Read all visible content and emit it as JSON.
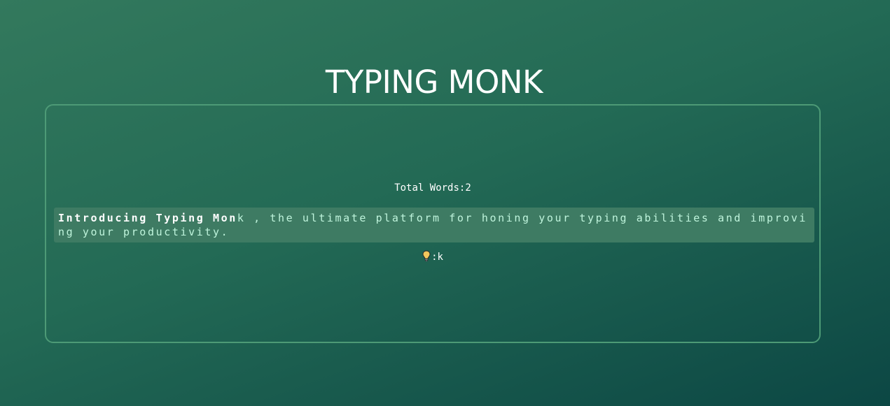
{
  "app": {
    "title": "TYPING MONK"
  },
  "stats": {
    "total_words_label": "Total Words:",
    "total_words_value": "2"
  },
  "typing": {
    "typed_text": "Introducing Typing Mon",
    "remaining_text": "k , the ultimate platform for honing your typing abilities and improving your productivity."
  },
  "hint": {
    "icon": "lightbulb-icon",
    "separator": ":",
    "next_char": "k"
  },
  "colors": {
    "background_start": "#33795d",
    "background_end": "#0c4744",
    "panel_border": "#4d9a76",
    "text_area_bg": "#3e7b63",
    "remaining_text": "#bff4dc",
    "typed_text": "#ffffff",
    "bulb": "#f2c75c"
  }
}
